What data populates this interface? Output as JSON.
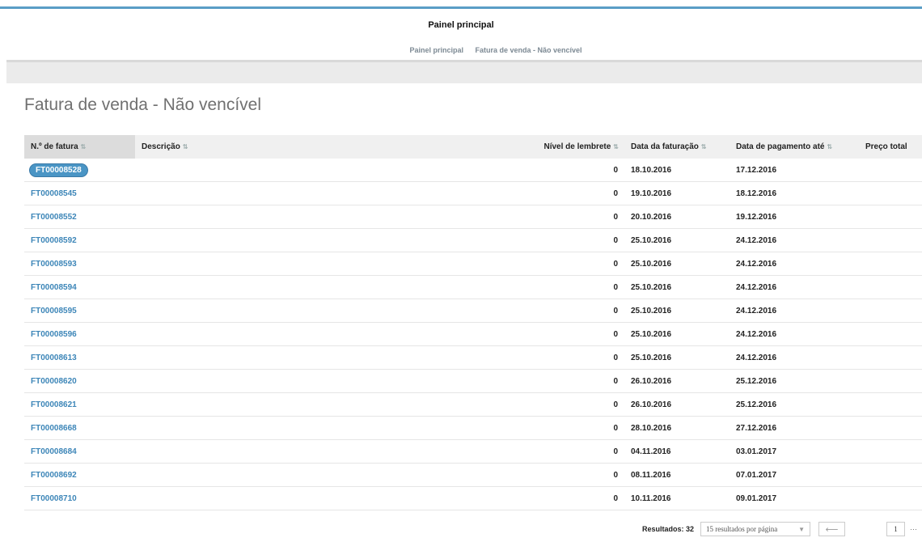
{
  "header": {
    "title": "Painel principal"
  },
  "breadcrumb": [
    "Painel principal",
    "Fatura de venda - Não vencível"
  ],
  "page": {
    "title": "Fatura de venda - Não vencível"
  },
  "table": {
    "columns": [
      "N.º de fatura",
      "Descrição",
      "Nível de lembrete",
      "Data da faturação",
      "Data de pagamento até",
      "Preço total"
    ],
    "rows": [
      {
        "invoice": "FT00008528",
        "description": "",
        "reminder": "0",
        "invoice_date": "18.10.2016",
        "due_date": "17.12.2016",
        "total": ""
      },
      {
        "invoice": "FT00008545",
        "description": "",
        "reminder": "0",
        "invoice_date": "19.10.2016",
        "due_date": "18.12.2016",
        "total": ""
      },
      {
        "invoice": "FT00008552",
        "description": "",
        "reminder": "0",
        "invoice_date": "20.10.2016",
        "due_date": "19.12.2016",
        "total": ""
      },
      {
        "invoice": "FT00008592",
        "description": "",
        "reminder": "0",
        "invoice_date": "25.10.2016",
        "due_date": "24.12.2016",
        "total": ""
      },
      {
        "invoice": "FT00008593",
        "description": "",
        "reminder": "0",
        "invoice_date": "25.10.2016",
        "due_date": "24.12.2016",
        "total": ""
      },
      {
        "invoice": "FT00008594",
        "description": "",
        "reminder": "0",
        "invoice_date": "25.10.2016",
        "due_date": "24.12.2016",
        "total": ""
      },
      {
        "invoice": "FT00008595",
        "description": "",
        "reminder": "0",
        "invoice_date": "25.10.2016",
        "due_date": "24.12.2016",
        "total": ""
      },
      {
        "invoice": "FT00008596",
        "description": "",
        "reminder": "0",
        "invoice_date": "25.10.2016",
        "due_date": "24.12.2016",
        "total": ""
      },
      {
        "invoice": "FT00008613",
        "description": "",
        "reminder": "0",
        "invoice_date": "25.10.2016",
        "due_date": "24.12.2016",
        "total": ""
      },
      {
        "invoice": "FT00008620",
        "description": "",
        "reminder": "0",
        "invoice_date": "26.10.2016",
        "due_date": "25.12.2016",
        "total": ""
      },
      {
        "invoice": "FT00008621",
        "description": "",
        "reminder": "0",
        "invoice_date": "26.10.2016",
        "due_date": "25.12.2016",
        "total": ""
      },
      {
        "invoice": "FT00008668",
        "description": "",
        "reminder": "0",
        "invoice_date": "28.10.2016",
        "due_date": "27.12.2016",
        "total": ""
      },
      {
        "invoice": "FT00008684",
        "description": "",
        "reminder": "0",
        "invoice_date": "04.11.2016",
        "due_date": "03.01.2017",
        "total": ""
      },
      {
        "invoice": "FT00008692",
        "description": "",
        "reminder": "0",
        "invoice_date": "08.11.2016",
        "due_date": "07.01.2017",
        "total": ""
      },
      {
        "invoice": "FT00008710",
        "description": "",
        "reminder": "0",
        "invoice_date": "10.11.2016",
        "due_date": "09.01.2017",
        "total": ""
      }
    ]
  },
  "pagination": {
    "results_label": "Resultados: 32",
    "per_page": "15 resultados por página",
    "current_page": "1",
    "ellipsis": "···"
  },
  "icons": {
    "sort": "sort-arrows-icon",
    "dropdown": "chevron-down-icon",
    "prev": "arrow-left-icon"
  },
  "colors": {
    "accent": "#5a9ec6",
    "link": "#3d86b8",
    "selected_badge": "#4a95c5"
  }
}
